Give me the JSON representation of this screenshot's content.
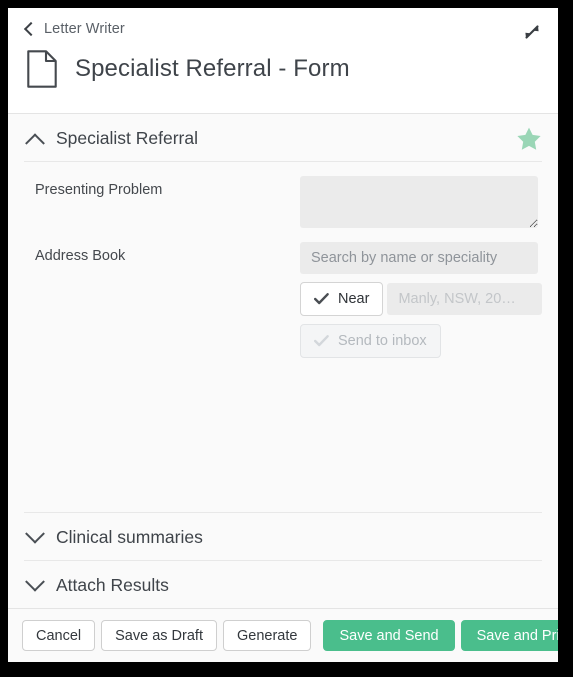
{
  "header": {
    "back_label": "Letter Writer",
    "back_icon": "chevron-left-icon",
    "doc_icon": "document-icon",
    "title": "Specialist Referral - Form",
    "expand_icon": "expand-diagonal-icon"
  },
  "sections": {
    "specialist_referral": {
      "title": "Specialist Referral",
      "chevron_icon": "chevron-up-icon",
      "star_icon": "star-icon",
      "star_color": "#9ad6b6",
      "fields": {
        "presenting_problem": {
          "label": "Presenting Problem",
          "value": "",
          "placeholder": ""
        },
        "address_book": {
          "label": "Address Book",
          "value": "",
          "placeholder": "Search by name or speciality"
        },
        "near": {
          "label": "Near",
          "icon": "check-icon",
          "location_value": "",
          "location_placeholder": "Manly, NSW, 20…"
        },
        "send_to_inbox": {
          "label": "Send to inbox",
          "icon": "check-icon"
        }
      }
    },
    "clinical_summaries": {
      "title": "Clinical summaries",
      "chevron_icon": "chevron-down-icon"
    },
    "attach_results": {
      "title": "Attach Results",
      "chevron_icon": "chevron-down-icon"
    }
  },
  "footer": {
    "cancel": "Cancel",
    "save_as_draft": "Save as Draft",
    "generate": "Generate",
    "save_and_send": "Save and Send",
    "save_and_print": "Save and Print",
    "primary_color": "#4abe8c"
  }
}
